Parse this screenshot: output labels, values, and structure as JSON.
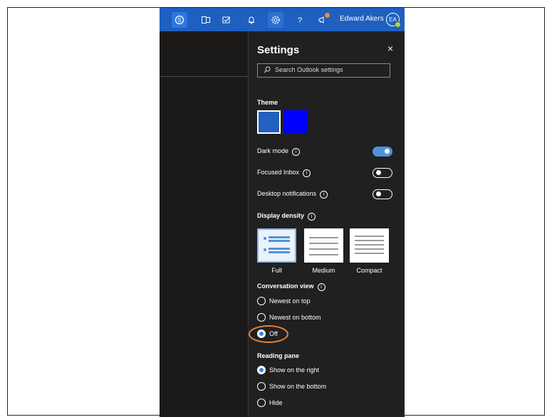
{
  "topbar": {
    "user_name": "Edward Akers",
    "avatar_initials": "EA",
    "icons": [
      "skype-icon",
      "word-icon",
      "todo-icon",
      "bell-icon",
      "gear-icon",
      "help-icon",
      "megaphone-icon"
    ]
  },
  "settings": {
    "title": "Settings",
    "close_glyph": "×",
    "search_placeholder": "Search Outlook settings",
    "theme_label": "Theme",
    "dark_mode_label": "Dark mode",
    "dark_mode_on": true,
    "focused_inbox_label": "Focused Inbox",
    "focused_inbox_on": false,
    "desktop_notifications_label": "Desktop notifications",
    "desktop_notifications_on": false,
    "display_density_label": "Display density",
    "density_options": [
      "Full",
      "Medium",
      "Compact"
    ],
    "density_selected": "Full",
    "conversation_view_label": "Conversation view",
    "conversation_options": [
      "Newest on top",
      "Newest on bottom",
      "Off"
    ],
    "conversation_selected": "Off",
    "reading_pane_label": "Reading pane",
    "reading_pane_options": [
      "Show on the right",
      "Show on the bottom",
      "Hide"
    ],
    "reading_pane_selected": "Show on the right"
  },
  "colors": {
    "topbar": "#1f5fbf",
    "accent": "#4f93d9",
    "highlight": "#e8833a",
    "theme_blue_1": "#2460bd",
    "theme_blue_2": "#0000ff"
  }
}
